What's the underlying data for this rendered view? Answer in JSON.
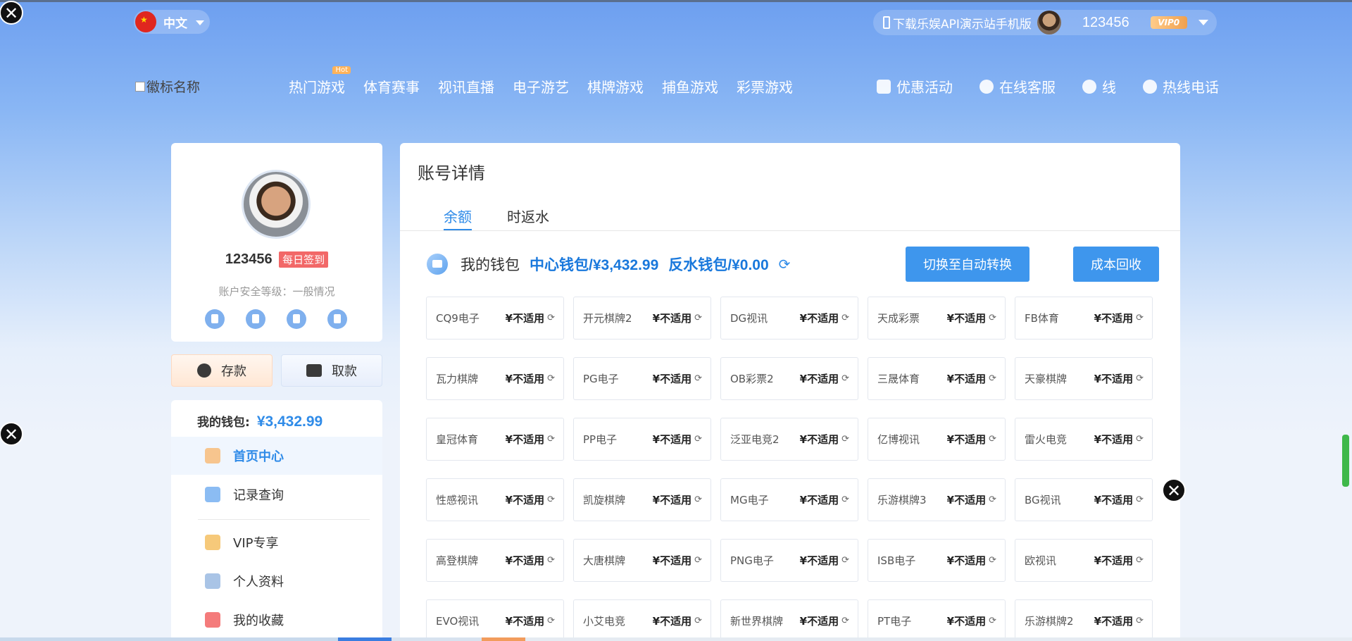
{
  "header": {
    "language": "中文",
    "download_text": "下载乐娱API演示站手机版",
    "username": "123456",
    "vip": "VIP0"
  },
  "nav": {
    "logo_alt": "徽标名称",
    "hot_tag": "Hot",
    "items": [
      "热门游戏",
      "体育赛事",
      "视讯直播",
      "电子游艺",
      "棋牌游戏",
      "捕鱼游戏",
      "彩票游戏"
    ],
    "right_items": [
      {
        "label": "优惠活动",
        "icon": "gift-icon"
      },
      {
        "label": "在线客服",
        "icon": "headset-icon"
      },
      {
        "label": "线",
        "icon": "line-icon"
      },
      {
        "label": "热线电话",
        "icon": "phone-icon"
      }
    ]
  },
  "profile": {
    "username": "123456",
    "sign_in": "每日签到",
    "security": "账户安全等级：一般情况",
    "deposit": "存款",
    "withdraw": "取款",
    "wallet_label": "我的钱包:",
    "wallet_amount": "¥3,432.99"
  },
  "menu": [
    {
      "label": "首页中心",
      "active": true,
      "icon": "home-icon",
      "color": "#f7c58e"
    },
    {
      "label": "记录查询",
      "active": false,
      "icon": "clipboard-icon",
      "color": "#8bbcf3"
    },
    {
      "label": "VIP专享",
      "active": false,
      "icon": "diamond-icon",
      "color": "#f6c97a"
    },
    {
      "label": "个人资料",
      "active": false,
      "icon": "id-card-icon",
      "color": "#a9c4e6"
    },
    {
      "label": "我的收藏",
      "active": false,
      "icon": "star-icon",
      "color": "#f47b7b"
    }
  ],
  "account": {
    "title": "账号详情",
    "tabs": [
      "余额",
      "时返水"
    ],
    "my_wallet": "我的钱包",
    "center_wallet": "中心钱包/¥3,432.99",
    "rebate_wallet": "反水钱包/¥0.00",
    "auto_transfer": "切换至自动转换",
    "recover": "成本回收"
  },
  "games": [
    {
      "name": "CQ9电子",
      "value": "¥不适用"
    },
    {
      "name": "开元棋牌2",
      "value": "¥不适用"
    },
    {
      "name": "DG视讯",
      "value": "¥不适用"
    },
    {
      "name": "天成彩票",
      "value": "¥不适用"
    },
    {
      "name": "FB体育",
      "value": "¥不适用"
    },
    {
      "name": "瓦力棋牌",
      "value": "¥不适用"
    },
    {
      "name": "PG电子",
      "value": "¥不适用"
    },
    {
      "name": "OB彩票2",
      "value": "¥不适用"
    },
    {
      "name": "三晟体育",
      "value": "¥不适用"
    },
    {
      "name": "天豪棋牌",
      "value": "¥不适用"
    },
    {
      "name": "皇冠体育",
      "value": "¥不适用"
    },
    {
      "name": "PP电子",
      "value": "¥不适用"
    },
    {
      "name": "泛亚电竞2",
      "value": "¥不适用"
    },
    {
      "name": "亿博视讯",
      "value": "¥不适用"
    },
    {
      "name": "雷火电竞",
      "value": "¥不适用"
    },
    {
      "name": "性感视讯",
      "value": "¥不适用"
    },
    {
      "name": "凯旋棋牌",
      "value": "¥不适用"
    },
    {
      "name": "MG电子",
      "value": "¥不适用"
    },
    {
      "name": "乐游棋牌3",
      "value": "¥不适用"
    },
    {
      "name": "BG视讯",
      "value": "¥不适用"
    },
    {
      "name": "高登棋牌",
      "value": "¥不适用"
    },
    {
      "name": "大唐棋牌",
      "value": "¥不适用"
    },
    {
      "name": "PNG电子",
      "value": "¥不适用"
    },
    {
      "name": "ISB电子",
      "value": "¥不适用"
    },
    {
      "name": "欧视讯",
      "value": "¥不适用"
    },
    {
      "name": "EVO视讯",
      "value": "¥不适用"
    },
    {
      "name": "小艾电竞",
      "value": "¥不适用"
    },
    {
      "name": "新世界棋牌",
      "value": "¥不适用"
    },
    {
      "name": "PT电子",
      "value": "¥不适用"
    },
    {
      "name": "乐游棋牌2",
      "value": "¥不适用"
    }
  ],
  "close_symbol": "✕"
}
